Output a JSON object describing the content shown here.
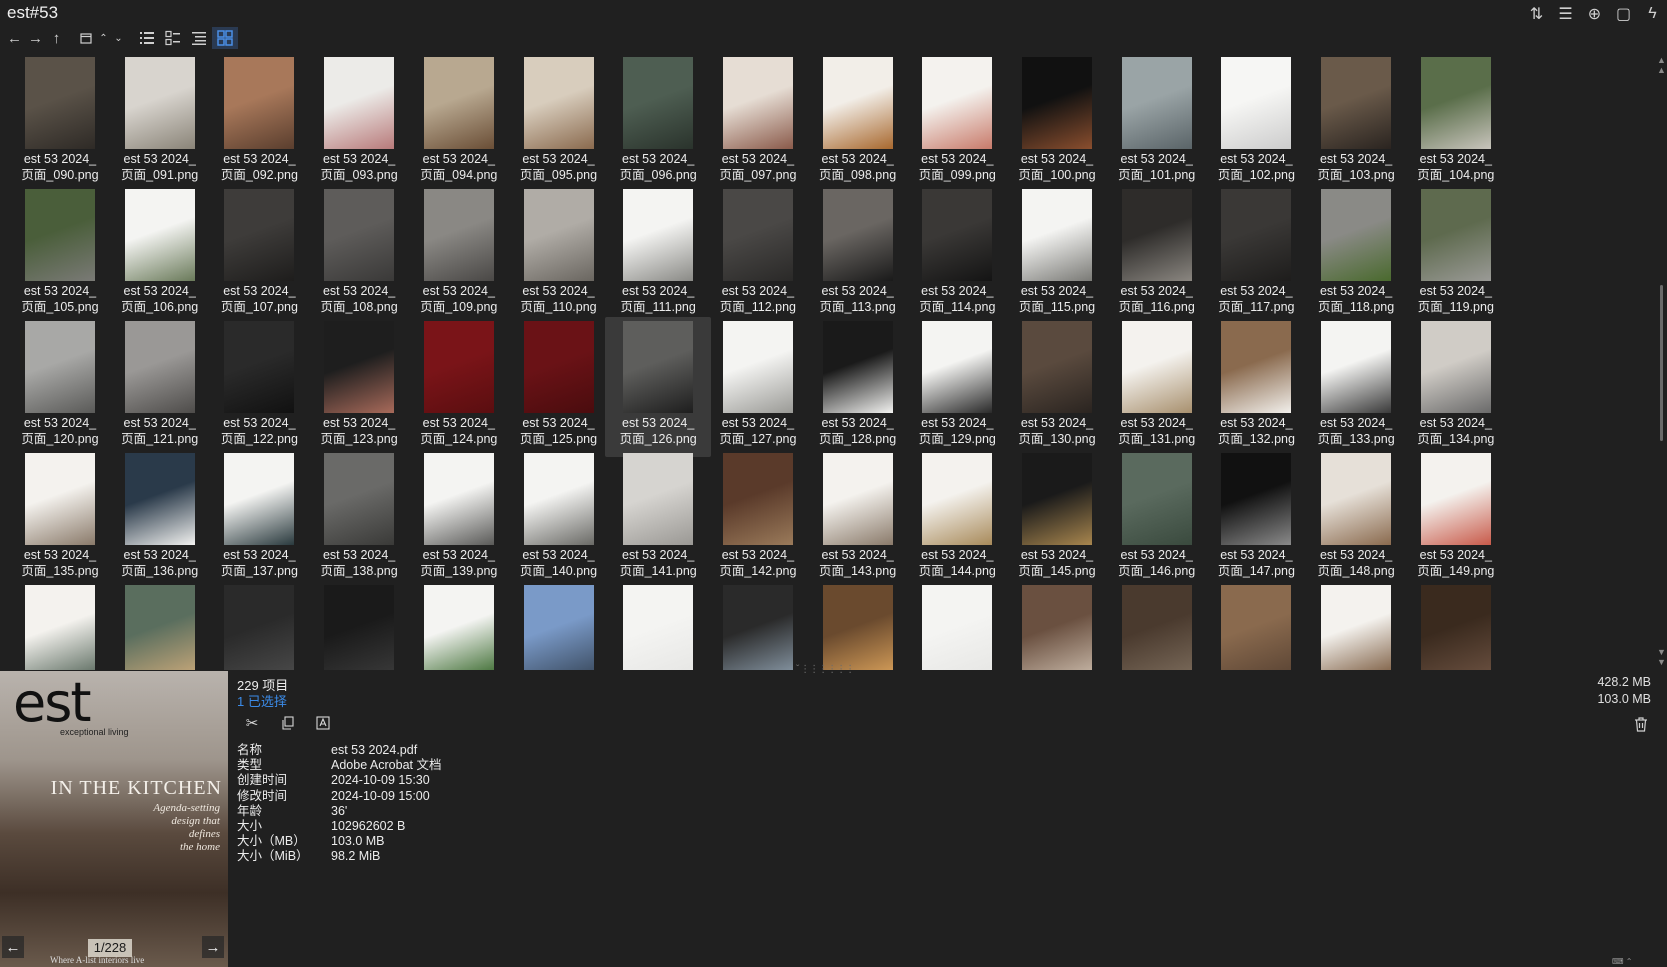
{
  "window": {
    "title": "est#53"
  },
  "titlebar_icons": [
    "sort-icon",
    "list-details-icon",
    "add-circle-icon",
    "clipboard-icon",
    "flash-icon"
  ],
  "toolbar": {
    "nav": [
      "back-arrow-icon",
      "forward-arrow-icon",
      "up-arrow-icon"
    ],
    "view_modes": [
      "list-view-icon",
      "details-view-icon",
      "tree-view-icon",
      "thumbnail-view-icon"
    ],
    "active_view": "thumbnail-view-icon"
  },
  "thumbnails": [
    {
      "line1": "est 53 2024_",
      "line2": "页面_090.png",
      "c1": "#5a5248",
      "c2": "#2e2a26"
    },
    {
      "line1": "est 53 2024_",
      "line2": "页面_091.png",
      "c1": "#d8d4ce",
      "c2": "#8a8478"
    },
    {
      "line1": "est 53 2024_",
      "line2": "页面_092.png",
      "c1": "#a8785a",
      "c2": "#5a3e2e"
    },
    {
      "line1": "est 53 2024_",
      "line2": "页面_093.png",
      "c1": "#ecebe8",
      "c2": "#b87a7a"
    },
    {
      "line1": "est 53 2024_",
      "line2": "页面_094.png",
      "c1": "#b8a890",
      "c2": "#6a4e36"
    },
    {
      "line1": "est 53 2024_",
      "line2": "页面_095.png",
      "c1": "#d8cdbd",
      "c2": "#8a6a4e"
    },
    {
      "line1": "est 53 2024_",
      "line2": "页面_096.png",
      "c1": "#4e5e52",
      "c2": "#2a332c"
    },
    {
      "line1": "est 53 2024_",
      "line2": "页面_097.png",
      "c1": "#e6ddd4",
      "c2": "#8a5a4a"
    },
    {
      "line1": "est 53 2024_",
      "line2": "页面_098.png",
      "c1": "#f2eee8",
      "c2": "#a8682e"
    },
    {
      "line1": "est 53 2024_",
      "line2": "页面_099.png",
      "c1": "#f4f2ee",
      "c2": "#c87a6a"
    },
    {
      "line1": "est 53 2024_",
      "line2": "页面_100.png",
      "c1": "#111111",
      "c2": "#8a4e2e"
    },
    {
      "line1": "est 53 2024_",
      "line2": "页面_101.png",
      "c1": "#9aa4a6",
      "c2": "#5a6468"
    },
    {
      "line1": "est 53 2024_",
      "line2": "页面_102.png",
      "c1": "#f6f6f4",
      "c2": "#cccccc"
    },
    {
      "line1": "est 53 2024_",
      "line2": "页面_103.png",
      "c1": "#6a5a4a",
      "c2": "#2a2420"
    },
    {
      "line1": "est 53 2024_",
      "line2": "页面_104.png",
      "c1": "#5a6e4a",
      "c2": "#c8c4bc"
    },
    {
      "line1": "est 53 2024_",
      "line2": "页面_105.png",
      "c1": "#4a5e3a",
      "c2": "#7a7a76"
    },
    {
      "line1": "est 53 2024_",
      "line2": "页面_106.png",
      "c1": "#f4f4f2",
      "c2": "#6a7a5a"
    },
    {
      "line1": "est 53 2024_",
      "line2": "页面_107.png",
      "c1": "#3e3c3a",
      "c2": "#1e1d1c"
    },
    {
      "line1": "est 53 2024_",
      "line2": "页面_108.png",
      "c1": "#5e5c5a",
      "c2": "#3a3938"
    },
    {
      "line1": "est 53 2024_",
      "line2": "页面_109.png",
      "c1": "#8a8884",
      "c2": "#4a4846"
    },
    {
      "line1": "est 53 2024_",
      "line2": "页面_110.png",
      "c1": "#b0aca6",
      "c2": "#6a6660"
    },
    {
      "line1": "est 53 2024_",
      "line2": "页面_111.png",
      "c1": "#f4f4f2",
      "c2": "#8a8a86"
    },
    {
      "line1": "est 53 2024_",
      "line2": "页面_112.png",
      "c1": "#4a4846",
      "c2": "#2a2928"
    },
    {
      "line1": "est 53 2024_",
      "line2": "页面_113.png",
      "c1": "#6a6662",
      "c2": "#1a1a1a"
    },
    {
      "line1": "est 53 2024_",
      "line2": "页面_114.png",
      "c1": "#3a3836",
      "c2": "#141414"
    },
    {
      "line1": "est 53 2024_",
      "line2": "页面_115.png",
      "c1": "#f4f4f2",
      "c2": "#7a7a76"
    },
    {
      "line1": "est 53 2024_",
      "line2": "页面_116.png",
      "c1": "#2e2c2a",
      "c2": "#8a8680"
    },
    {
      "line1": "est 53 2024_",
      "line2": "页面_117.png",
      "c1": "#3a3836",
      "c2": "#1e1d1c"
    },
    {
      "line1": "est 53 2024_",
      "line2": "页面_118.png",
      "c1": "#8a8a86",
      "c2": "#4a6a2e"
    },
    {
      "line1": "est 53 2024_",
      "line2": "页面_119.png",
      "c1": "#5e6a4e",
      "c2": "#9a9a96"
    },
    {
      "line1": "est 53 2024_",
      "line2": "页面_120.png",
      "c1": "#a8a8a6",
      "c2": "#5a5a58"
    },
    {
      "line1": "est 53 2024_",
      "line2": "页面_121.png",
      "c1": "#9a9896",
      "c2": "#4e4c4a"
    },
    {
      "line1": "est 53 2024_",
      "line2": "页面_122.png",
      "c1": "#2a2a2a",
      "c2": "#111111"
    },
    {
      "line1": "est 53 2024_",
      "line2": "页面_123.png",
      "c1": "#1e1e1e",
      "c2": "#a86a5a"
    },
    {
      "line1": "est 53 2024_",
      "line2": "页面_124.png",
      "c1": "#7a1418",
      "c2": "#5a0e10"
    },
    {
      "line1": "est 53 2024_",
      "line2": "页面_125.png",
      "c1": "#6a1216",
      "c2": "#4a0c0e"
    },
    {
      "line1": "est 53 2024_",
      "line2": "页面_126.png",
      "c1": "#5e5e5c",
      "c2": "#1e1e1e"
    },
    {
      "line1": "est 53 2024_",
      "line2": "页面_127.png",
      "c1": "#f4f4f2",
      "c2": "#9a9a96"
    },
    {
      "line1": "est 53 2024_",
      "line2": "页面_128.png",
      "c1": "#1a1a1a",
      "c2": "#f2f2f0"
    },
    {
      "line1": "est 53 2024_",
      "line2": "页面_129.png",
      "c1": "#f4f4f2",
      "c2": "#2a2a2a"
    },
    {
      "line1": "est 53 2024_",
      "line2": "页面_130.png",
      "c1": "#5a4a3e",
      "c2": "#2a2420"
    },
    {
      "line1": "est 53 2024_",
      "line2": "页面_131.png",
      "c1": "#f4f2ee",
      "c2": "#a8906e"
    },
    {
      "line1": "est 53 2024_",
      "line2": "页面_132.png",
      "c1": "#8a6a4e",
      "c2": "#f2f0ec"
    },
    {
      "line1": "est 53 2024_",
      "line2": "页面_133.png",
      "c1": "#f4f4f2",
      "c2": "#3a3a3a"
    },
    {
      "line1": "est 53 2024_",
      "line2": "页面_134.png",
      "c1": "#d0ccc6",
      "c2": "#6a6a6a"
    },
    {
      "line1": "est 53 2024_",
      "line2": "页面_135.png",
      "c1": "#f4f2ee",
      "c2": "#8a7a6a"
    },
    {
      "line1": "est 53 2024_",
      "line2": "页面_136.png",
      "c1": "#2a3a4a",
      "c2": "#f2f2f0"
    },
    {
      "line1": "est 53 2024_",
      "line2": "页面_137.png",
      "c1": "#f4f4f2",
      "c2": "#2a3a3e"
    },
    {
      "line1": "est 53 2024_",
      "line2": "页面_138.png",
      "c1": "#6a6a68",
      "c2": "#3a3a38"
    },
    {
      "line1": "est 53 2024_",
      "line2": "页面_139.png",
      "c1": "#f4f4f2",
      "c2": "#5a5a58"
    },
    {
      "line1": "est 53 2024_",
      "line2": "页面_140.png",
      "c1": "#f4f4f2",
      "c2": "#6a6a66"
    },
    {
      "line1": "est 53 2024_",
      "line2": "页面_141.png",
      "c1": "#d6d4d0",
      "c2": "#9a9894"
    },
    {
      "line1": "est 53 2024_",
      "line2": "页面_142.png",
      "c1": "#5a3a2a",
      "c2": "#9a7a5a"
    },
    {
      "line1": "est 53 2024_",
      "line2": "页面_143.png",
      "c1": "#f4f2ee",
      "c2": "#8a7a6a"
    },
    {
      "line1": "est 53 2024_",
      "line2": "页面_144.png",
      "c1": "#f4f2ee",
      "c2": "#a88a5a"
    },
    {
      "line1": "est 53 2024_",
      "line2": "页面_145.png",
      "c1": "#1a1a1a",
      "c2": "#a8864e"
    },
    {
      "line1": "est 53 2024_",
      "line2": "页面_146.png",
      "c1": "#5a6a5e",
      "c2": "#3a4a3e"
    },
    {
      "line1": "est 53 2024_",
      "line2": "页面_147.png",
      "c1": "#111111",
      "c2": "#8a8a8a"
    },
    {
      "line1": "est 53 2024_",
      "line2": "页面_148.png",
      "c1": "#e6e0d8",
      "c2": "#8a6a4e"
    },
    {
      "line1": "est 53 2024_",
      "line2": "页面_149.png",
      "c1": "#f4f2ee",
      "c2": "#c85a4a"
    },
    {
      "line1": "",
      "line2": "",
      "c1": "#f4f2ee",
      "c2": "#5a6a5e"
    },
    {
      "line1": "",
      "line2": "",
      "c1": "#5a6e5e",
      "c2": "#c8a87a"
    },
    {
      "line1": "",
      "line2": "",
      "c1": "#2a2a2a",
      "c2": "#4a4a4a"
    },
    {
      "line1": "",
      "line2": "",
      "c1": "#1a1a1a",
      "c2": "#3a3a3a"
    },
    {
      "line1": "",
      "line2": "",
      "c1": "#f4f4f2",
      "c2": "#3a6a2e"
    },
    {
      "line1": "",
      "line2": "",
      "c1": "#7a9ac8",
      "c2": "#3a4a5e"
    },
    {
      "line1": "",
      "line2": "",
      "c1": "#f4f4f2",
      "c2": "#e6e6e4"
    },
    {
      "line1": "",
      "line2": "",
      "c1": "#2a2a2a",
      "c2": "#8a9aa8"
    },
    {
      "line1": "",
      "line2": "",
      "c1": "#6a4a2e",
      "c2": "#d8a05a"
    },
    {
      "line1": "",
      "line2": "",
      "c1": "#f4f4f2",
      "c2": "#e6e6e4"
    },
    {
      "line1": "",
      "line2": "",
      "c1": "#6a5040",
      "c2": "#c8b8a8"
    },
    {
      "line1": "",
      "line2": "",
      "c1": "#4a3a2e",
      "c2": "#7a6a5a"
    },
    {
      "line1": "",
      "line2": "",
      "c1": "#8a6a4e",
      "c2": "#5a4434"
    },
    {
      "line1": "",
      "line2": "",
      "c1": "#f4f2ee",
      "c2": "#7a5a3e"
    },
    {
      "line1": "",
      "line2": "",
      "c1": "#3a2a1e",
      "c2": "#6a5040"
    }
  ],
  "selected_index": 36,
  "preview": {
    "logo": "est",
    "tagline": "exceptional living",
    "headline": "IN THE KITCHEN",
    "subtitle": "Agenda-setting\ndesign that\ndefines\nthe home",
    "counter": "1/228",
    "footer": "Where A-list  interiors live"
  },
  "summary": {
    "count": "229 项目",
    "selected": "1 已选择"
  },
  "actions": [
    "cut-icon",
    "copy-icon",
    "rename-icon"
  ],
  "properties": [
    {
      "key": "名称",
      "value": "est 53 2024.pdf"
    },
    {
      "key": "类型",
      "value": "Adobe Acrobat 文档"
    },
    {
      "key": "创建时间",
      "value": "2024-10-09  15:30"
    },
    {
      "key": "修改时间",
      "value": "2024-10-09  15:00"
    },
    {
      "key": "年龄",
      "value": "36'"
    },
    {
      "key": "大小",
      "value": "102962602 B"
    },
    {
      "key": "大小（MB）",
      "value": "103.0 MB"
    },
    {
      "key": "大小（MiB）",
      "value": "98.2 MiB"
    }
  ],
  "sizes": {
    "total": "428.2 MB",
    "selected": "103.0 MB"
  }
}
